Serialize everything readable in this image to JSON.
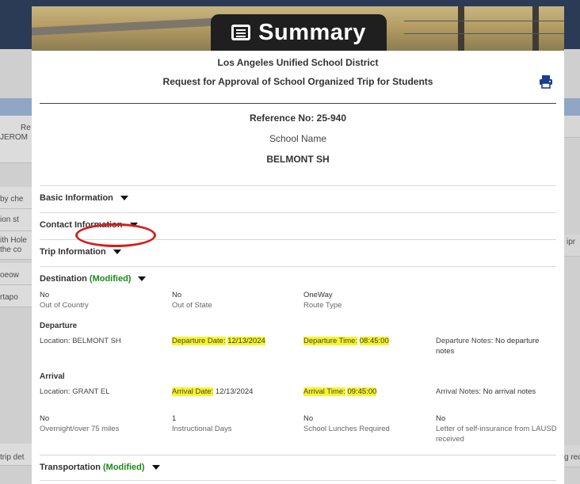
{
  "background": {
    "left_fragments": [
      "Re",
      "JEROM",
      "by che",
      "ion st",
      "ith Hole",
      "the co",
      "oeow",
      "rtapo",
      "trip det"
    ],
    "right_fragments": [
      "ipr",
      "g req"
    ]
  },
  "modal": {
    "title": "Summary",
    "district": "Los Angeles Unified School District",
    "request_title": "Request for Approval of School Organized Trip for Students",
    "reference": "Reference No: 25-940",
    "school_label": "School Name",
    "school_name": "BELMONT SH"
  },
  "sections": {
    "basic": "Basic Information",
    "contact": "Contact Information",
    "trip": "Trip Information",
    "destination": "Destination",
    "destination_status": "(Modified)",
    "transportation": "Transportation",
    "transportation_status": "(Modified)"
  },
  "destination": {
    "out_of_country": {
      "value": "No",
      "label": "Out of Country"
    },
    "out_of_state": {
      "value": "No",
      "label": "Out of State"
    },
    "route_type": {
      "value": "OneWay",
      "label": "Route Type"
    },
    "departure": {
      "heading": "Departure",
      "location": "Location: BELMONT SH",
      "date_label": "Departure Date:",
      "date": "12/13/2024",
      "time_label": "Departure Time:",
      "time": "08:45:00",
      "notes_label": "Departure Notes:",
      "notes_line1": "No departure",
      "notes_line2": "notes"
    },
    "arrival": {
      "heading": "Arrival",
      "location": "Location: GRANT EL",
      "date_label": "Arrival Date:",
      "date": "12/13/2024",
      "time_label": "Arrival Time:",
      "time": "09:45:00",
      "notes_label": "Arrival Notes:",
      "notes": "No arrival notes"
    },
    "overnight": {
      "value": "No",
      "label": "Overnight/over 75 miles"
    },
    "instructional_days": {
      "value": "1",
      "label": "Instructional Days"
    },
    "school_lunches": {
      "value": "No",
      "label": "School Lunches Required"
    },
    "self_insurance": {
      "value": "No",
      "label_line1": "Letter of self-insurance from LAUSD",
      "label_line2": "received"
    }
  },
  "colors": {
    "modified": "#1c8a1c",
    "highlight": "#f6f52a",
    "annotation": "#d21f1f",
    "print_icon": "#1a3f8f"
  },
  "icons": {
    "title": "summary-list-icon",
    "print": "printer-icon",
    "caret": "caret-down-icon"
  }
}
